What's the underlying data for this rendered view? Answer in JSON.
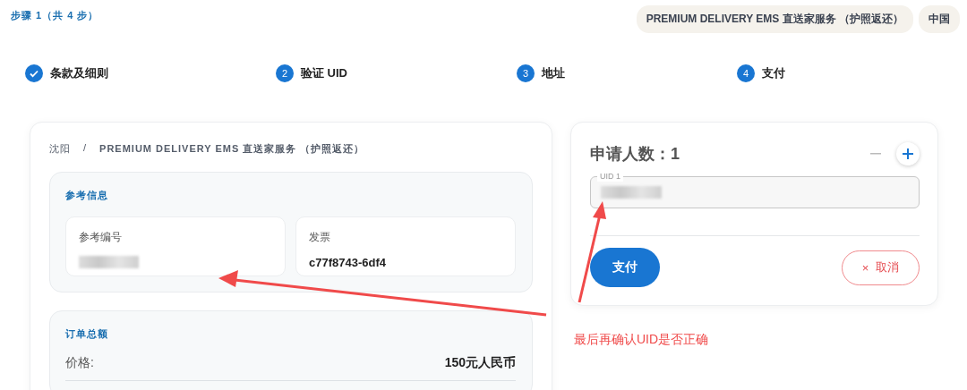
{
  "header": {
    "step_counter": "步骤 1（共 4 步）",
    "chips": [
      "PREMIUM DELIVERY EMS 直送家服务 （护照返还）",
      "中国"
    ]
  },
  "steps": [
    {
      "label": "条款及细则",
      "done": true
    },
    {
      "number": "2",
      "label": "验证 UID",
      "done": false
    },
    {
      "number": "3",
      "label": "地址",
      "done": false
    },
    {
      "number": "4",
      "label": "支付",
      "done": false
    }
  ],
  "breadcrumb": [
    "沈阳",
    "/",
    "PREMIUM DELIVERY EMS 直送家服务 （护照返还）"
  ],
  "reference": {
    "title": "参考信息",
    "cards": [
      {
        "label": "参考编号",
        "kind": "redacted"
      },
      {
        "label": "发票",
        "value": "c77f8743-6df4",
        "kind": "text"
      }
    ]
  },
  "order_total": {
    "title": "订单总额",
    "rows": [
      {
        "label": "价格:",
        "value": "150元人民币"
      }
    ]
  },
  "applicants": {
    "title": "申请人数：1",
    "fields": [
      {
        "label": "UID 1",
        "kind": "redacted"
      }
    ],
    "pay_button": "支付",
    "cancel_button": "取消",
    "cancel_icon": "×"
  },
  "annotation": {
    "text": "最后再确认UID是否正确"
  }
}
